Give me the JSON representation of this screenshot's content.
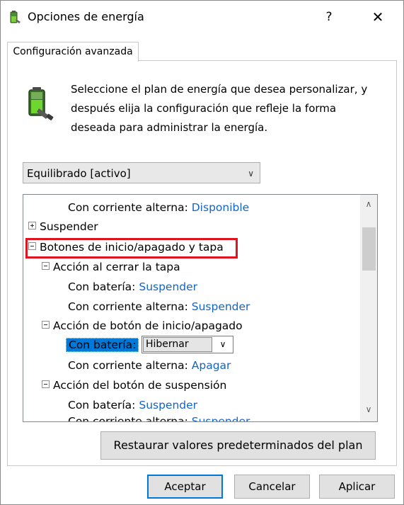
{
  "window": {
    "title": "Opciones de energía",
    "help_glyph": "?",
    "close_glyph": "✕"
  },
  "tab": {
    "label": "Configuración avanzada"
  },
  "description": "Seleccione el plan de energía que desea personalizar, y después elija la configuración que refleje la forma deseada para administrar la energía.",
  "plan_select": {
    "value": "Equilibrado [activo]"
  },
  "tree": {
    "rows": [
      {
        "label": "Con corriente alterna:",
        "value": "Disponible"
      },
      {
        "label": "Suspender",
        "toggle": "plus"
      },
      {
        "label": "Botones de inicio/apagado y tapa",
        "toggle": "minus",
        "highlighted": true
      },
      {
        "label": "Acción al cerrar la tapa",
        "toggle": "minus"
      },
      {
        "label": "Con batería:",
        "value": "Suspender"
      },
      {
        "label": "Con corriente alterna:",
        "value": "Suspender"
      },
      {
        "label": "Acción de botón de inicio/apagado",
        "toggle": "minus"
      },
      {
        "label": "Con batería:",
        "selected": true,
        "dropdown_value": "Hibernar"
      },
      {
        "label": "Con corriente alterna:",
        "value": "Apagar"
      },
      {
        "label": "Acción del botón de suspensión",
        "toggle": "minus"
      },
      {
        "label": "Con batería:",
        "value": "Suspender"
      },
      {
        "label": "Con corriente alterna:",
        "value": "Suspender"
      }
    ]
  },
  "buttons": {
    "restore": "Restaurar valores predeterminados del plan",
    "ok": "Aceptar",
    "cancel": "Cancelar",
    "apply": "Aplicar"
  },
  "colors": {
    "link_value": "#1464c8",
    "highlight_box": "#e0141e",
    "selection": "#0078d7"
  }
}
